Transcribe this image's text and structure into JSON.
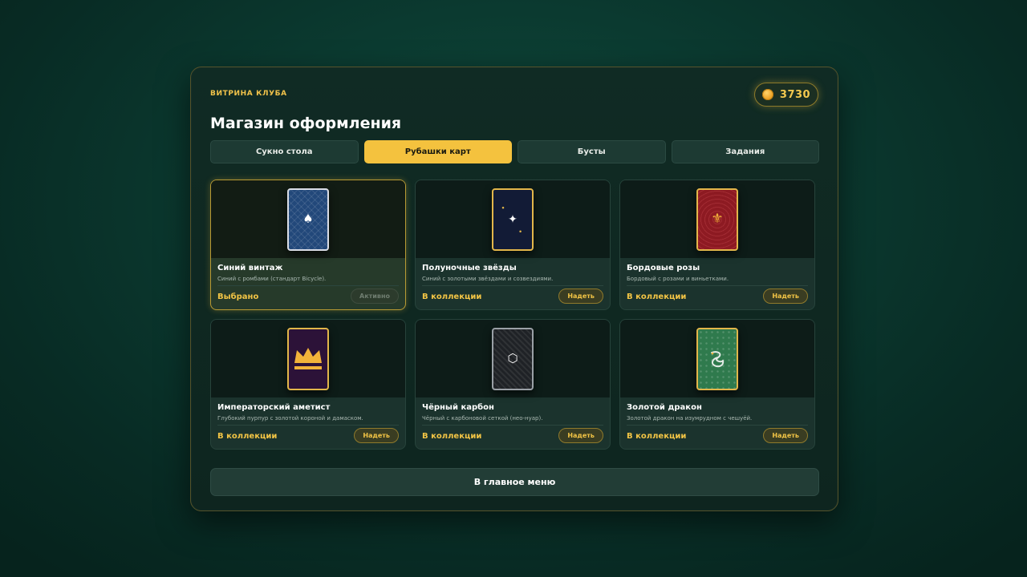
{
  "header": {
    "eyebrow": "ВИТРИНА КЛУБА",
    "title": "Магазин оформления",
    "coins": "3730",
    "coin_icon": "coin-icon"
  },
  "tabs": [
    {
      "label": "Сукно стола",
      "active": false
    },
    {
      "label": "Рубашки карт",
      "active": true
    },
    {
      "label": "Бусты",
      "active": false
    },
    {
      "label": "Задания",
      "active": false
    }
  ],
  "items": [
    {
      "name": "Синий винтаж",
      "desc": "Синий с ромбами (стандарт Bicycle).",
      "status": "Выбрано",
      "button": "Активно",
      "selected": true,
      "icon": "spade-icon"
    },
    {
      "name": "Полуночные звёзды",
      "desc": "Синий с золотыми звёздами и созвездиями.",
      "status": "В коллекции",
      "button": "Надеть",
      "selected": false,
      "icon": "star-icon"
    },
    {
      "name": "Бордовые розы",
      "desc": "Бордовый с розами и виньетками.",
      "status": "В коллекции",
      "button": "Надеть",
      "selected": false,
      "icon": "fleur-de-lis-icon"
    },
    {
      "name": "Императорский аметист",
      "desc": "Глубокий пурпур с золотой короной и дамаском.",
      "status": "В коллекции",
      "button": "Надеть",
      "selected": false,
      "icon": "crown-icon"
    },
    {
      "name": "Чёрный карбон",
      "desc": "Чёрный с карбоновой сеткой (нео-нуар).",
      "status": "В коллекции",
      "button": "Надеть",
      "selected": false,
      "icon": "hexagon-icon"
    },
    {
      "name": "Золотой дракон",
      "desc": "Золотой дракон на изумрудном с чешуёй.",
      "status": "В коллекции",
      "button": "Надеть",
      "selected": false,
      "icon": "dragon-icon"
    }
  ],
  "footer": {
    "main_menu": "В главное меню"
  },
  "colors": {
    "accent": "#f4c23e",
    "panel": "#102b24"
  }
}
